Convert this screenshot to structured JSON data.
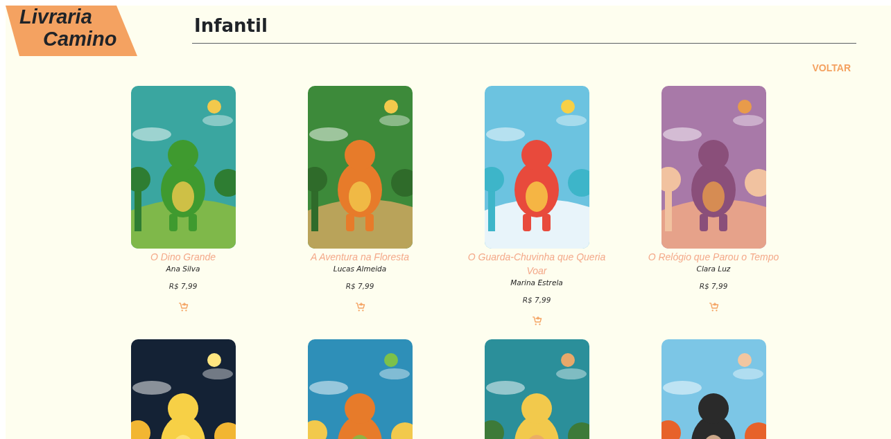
{
  "logo": {
    "line_1": "Livraria",
    "line_2": "Camino"
  },
  "header": {
    "title": "Infantil"
  },
  "back_link": "VOLTAR",
  "books": [
    {
      "cover": {
        "kind": "picture"
      },
      "title": "O Dino Grande",
      "author": "Ana Silva",
      "price": "R$ 7,99"
    },
    {
      "cover": {
        "kind": "picture"
      },
      "title": "A Aventura na Floresta",
      "author": "Lucas Almeida",
      "price": "R$ 7,99"
    },
    {
      "cover": {
        "kind": "picture"
      },
      "title": "O Guarda-Chuvinha que Queria Voar",
      "author": "Marina Estrela",
      "price": "R$ 7,99"
    },
    {
      "cover": {
        "kind": "picture"
      },
      "title": "O Relógio que Parou o Tempo",
      "author": "Clara Luz",
      "price": "R$ 7,99"
    },
    {
      "cover": {
        "kind": "picture"
      }
    },
    {
      "cover": {
        "kind": "picture"
      }
    },
    {
      "cover": {
        "kind": "picture"
      }
    },
    {
      "cover": {
        "kind": "picture"
      }
    }
  ]
}
